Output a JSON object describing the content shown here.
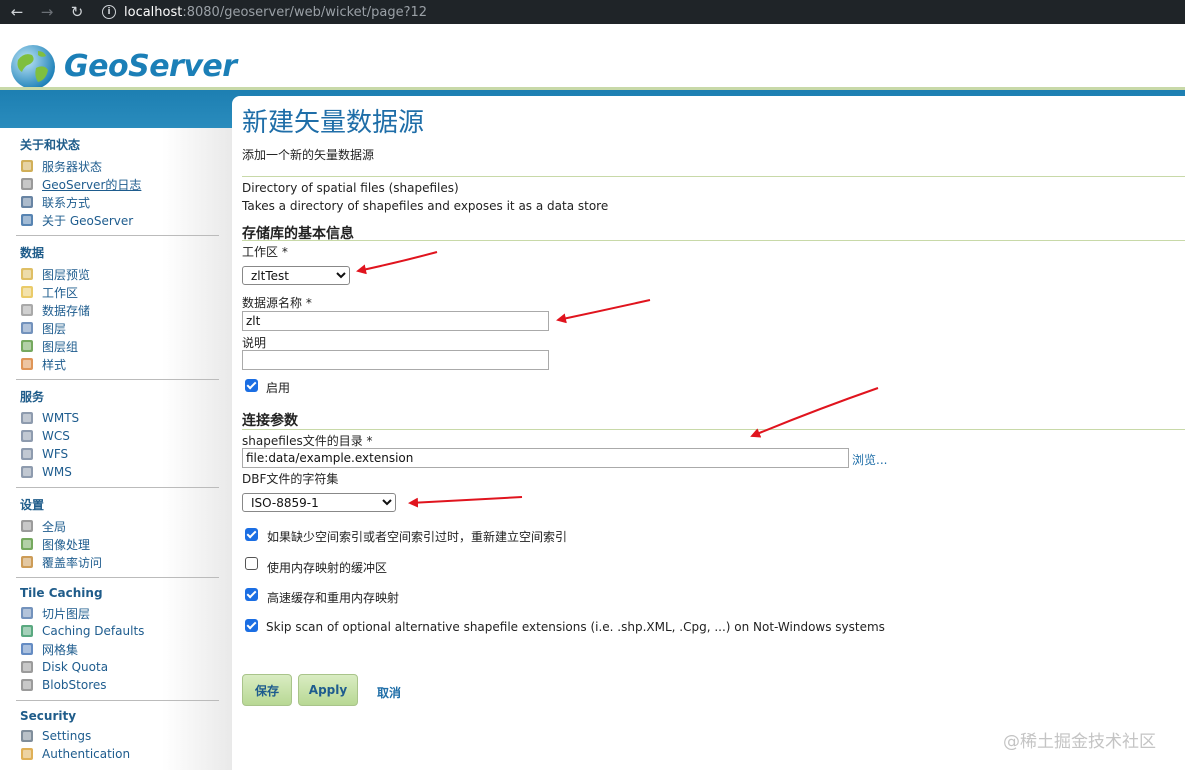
{
  "browser": {
    "url_host": "localhost",
    "url_rest": ":8080/geoserver/web/wicket/page?12"
  },
  "header": {
    "logo_text": "GeoServer"
  },
  "sidebar": {
    "sections": [
      {
        "title": "关于和状态",
        "items": [
          {
            "label": "服务器状态",
            "icon": "server-status-icon"
          },
          {
            "label": "GeoServer的日志",
            "icon": "log-icon"
          },
          {
            "label": "联系方式",
            "icon": "contact-icon"
          },
          {
            "label": "关于 GeoServer",
            "icon": "about-icon"
          }
        ]
      },
      {
        "title": "数据",
        "items": [
          {
            "label": "图层预览",
            "icon": "layer-preview-icon"
          },
          {
            "label": "工作区",
            "icon": "workspace-icon"
          },
          {
            "label": "数据存储",
            "icon": "store-icon"
          },
          {
            "label": "图层",
            "icon": "layer-icon"
          },
          {
            "label": "图层组",
            "icon": "layer-group-icon"
          },
          {
            "label": "样式",
            "icon": "style-icon"
          }
        ]
      },
      {
        "title": "服务",
        "items": [
          {
            "label": "WMTS",
            "icon": "service-icon"
          },
          {
            "label": "WCS",
            "icon": "service-icon"
          },
          {
            "label": "WFS",
            "icon": "service-icon"
          },
          {
            "label": "WMS",
            "icon": "service-icon"
          }
        ]
      },
      {
        "title": "设置",
        "items": [
          {
            "label": "全局",
            "icon": "global-icon"
          },
          {
            "label": "图像处理",
            "icon": "image-processing-icon"
          },
          {
            "label": "覆盖率访问",
            "icon": "coverage-access-icon"
          }
        ]
      },
      {
        "title": "Tile Caching",
        "items": [
          {
            "label": "切片图层",
            "icon": "tile-layers-icon"
          },
          {
            "label": "Caching Defaults",
            "icon": "caching-defaults-icon"
          },
          {
            "label": "网格集",
            "icon": "gridsets-icon"
          },
          {
            "label": "Disk Quota",
            "icon": "disk-quota-icon"
          },
          {
            "label": "BlobStores",
            "icon": "blobstores-icon"
          }
        ]
      },
      {
        "title": "Security",
        "items": [
          {
            "label": "Settings",
            "icon": "wrench-icon"
          },
          {
            "label": "Authentication",
            "icon": "authentication-icon"
          }
        ]
      }
    ]
  },
  "main": {
    "title": "新建矢量数据源",
    "subtitle": "添加一个新的矢量数据源",
    "store_type": "Directory of spatial files (shapefiles)",
    "store_desc": "Takes a directory of shapefiles and exposes it as a data store",
    "basic_section": "存储库的基本信息",
    "workspace_label": "工作区 *",
    "workspace_value": "zltTest",
    "name_label": "数据源名称 *",
    "name_value": "zlt",
    "desc_label": "说明",
    "desc_value": "",
    "enabled_label": "启用",
    "conn_section": "连接参数",
    "dir_label": "shapefiles文件的目录 *",
    "dir_value": "file:data/example.extension",
    "browse_label": "浏览...",
    "charset_label": "DBF文件的字符集",
    "charset_value": "ISO-8859-1",
    "opt_rebuild": "如果缺少空间索引或者空间索引过时，重新建立空间索引",
    "opt_memmap": "使用内存映射的缓冲区",
    "opt_cache": "高速缓存和重用内存映射",
    "opt_skip": "Skip scan of optional alternative shapefile extensions (i.e. .shp.XML, .Cpg, ...) on Not-Windows systems",
    "save_label": "保存",
    "apply_label": "Apply",
    "cancel_label": "取消"
  },
  "watermark": "@稀土掘金技术社区",
  "colors": {
    "accent": "#1f6ea8",
    "band": "#1d7fb2",
    "arrow": "#e0141e",
    "checkbox": "#1b6ee3"
  }
}
